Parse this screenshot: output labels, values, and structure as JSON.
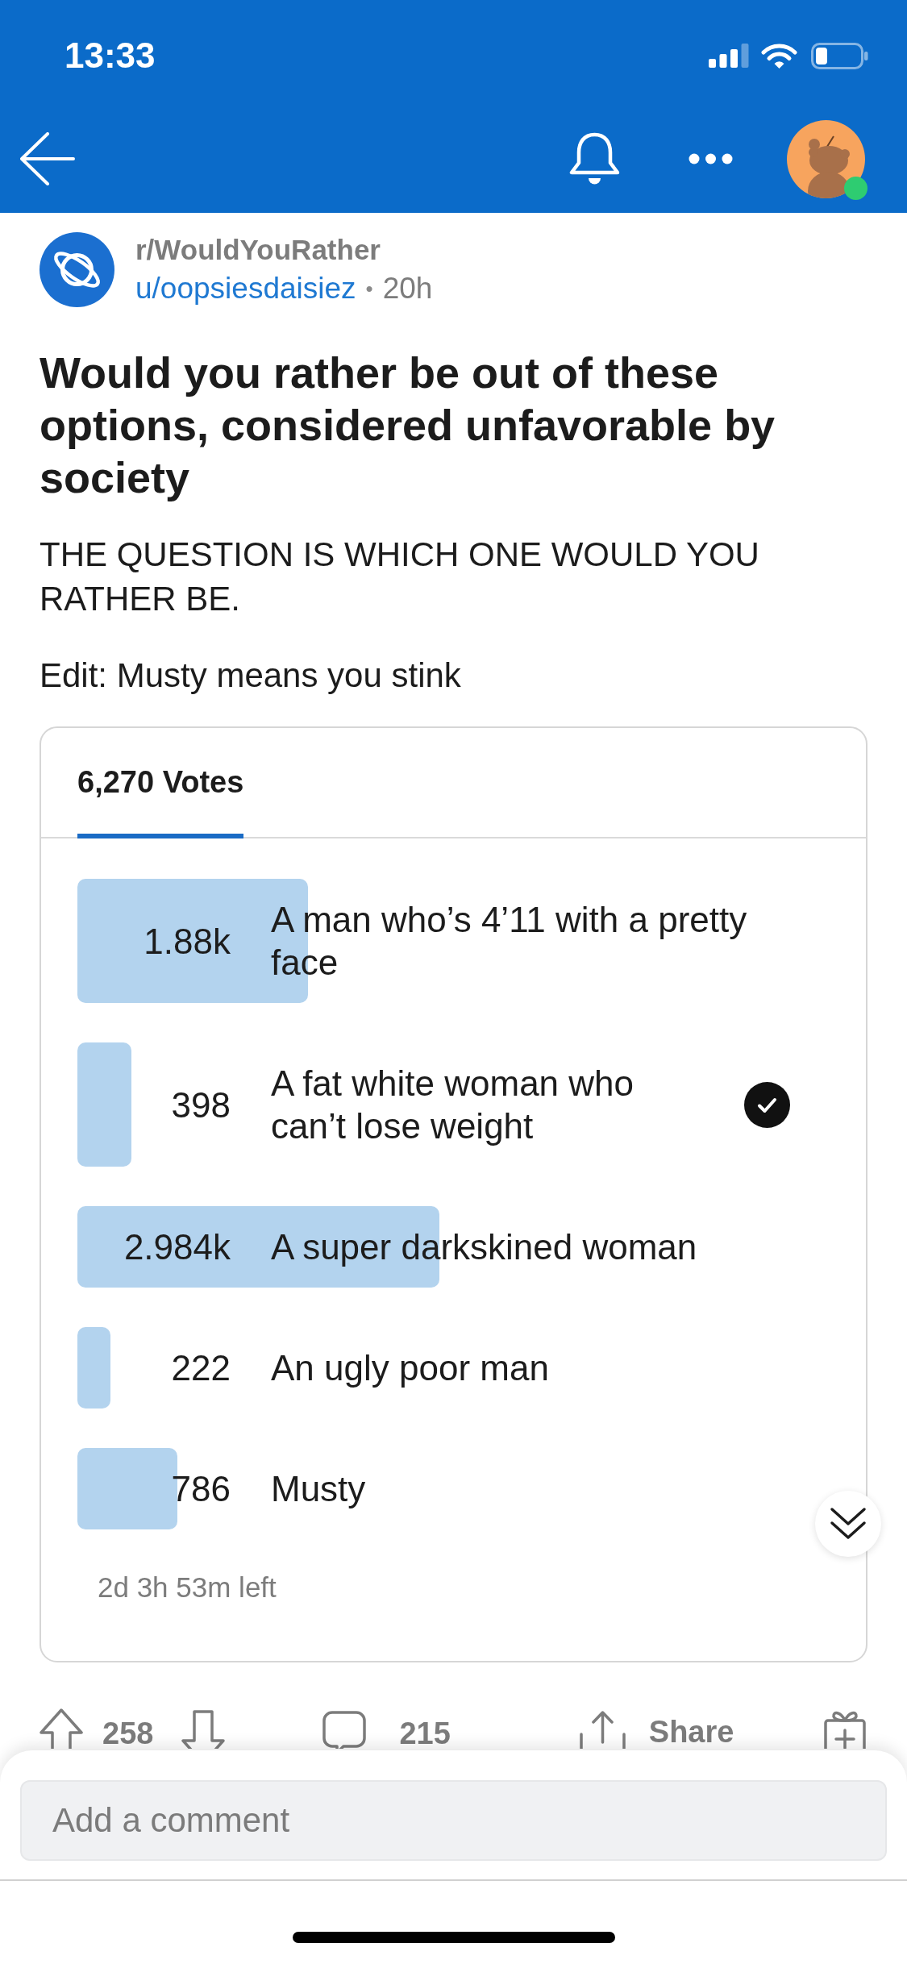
{
  "status_bar": {
    "time": "13:33"
  },
  "post": {
    "subreddit": "r/WouldYouRather",
    "author": "u/oopsiesdaisiez",
    "separator": "•",
    "age": "20h",
    "title": "Would you rather be out of these options, considered unfavorable by society",
    "body": [
      "THE QUESTION IS WHICH ONE WOULD YOU RATHER BE.",
      "Edit: Musty means you stink"
    ]
  },
  "poll": {
    "tabs": [
      {
        "label": "6,270 Votes",
        "selected": true
      }
    ],
    "options": [
      {
        "count": "1.88k",
        "label": "A man who’s 4’11 with a pretty face",
        "level": 0.306,
        "selected": false
      },
      {
        "count": "398",
        "label": "A fat white woman who can’t lose weight",
        "level": 0.072,
        "selected": true
      },
      {
        "count": "2.984k",
        "label": "A super darkskined woman",
        "level": 0.48,
        "selected": false
      },
      {
        "count": "222",
        "label": "An ugly poor man",
        "level": 0.044,
        "selected": false
      },
      {
        "count": "786",
        "label": "Musty",
        "level": 0.132,
        "selected": false
      }
    ],
    "time_left": "2d 3h 53m left"
  },
  "actions": {
    "upvotes": "258",
    "comments": "215",
    "share": "Share"
  },
  "comment_box": {
    "placeholder": "Add a comment"
  }
}
